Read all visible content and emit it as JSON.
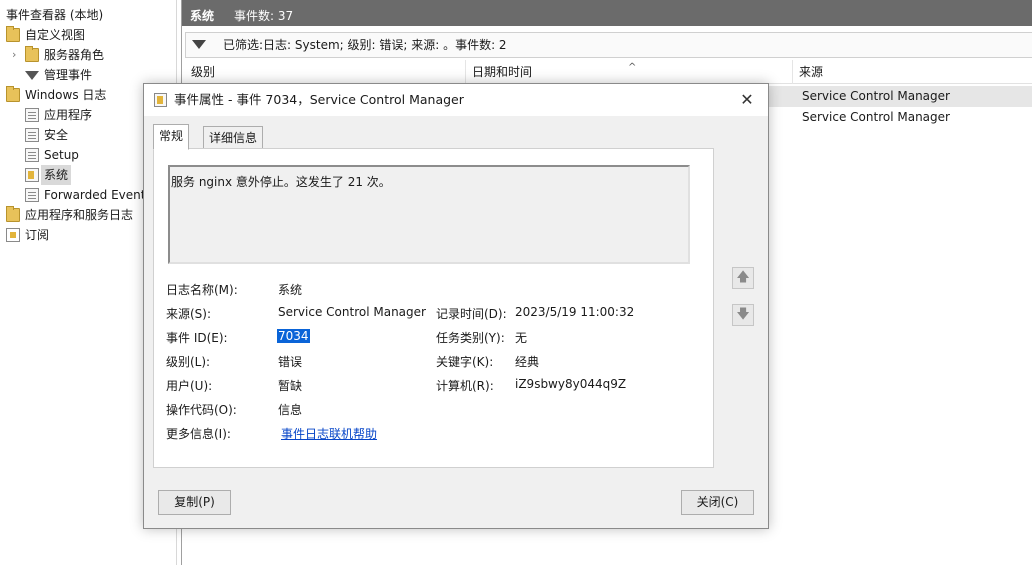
{
  "tree": {
    "root": "事件查看器 (本地)",
    "custom_views": "自定义视图",
    "server_roles": "服务器角色",
    "admin_events": "管理事件",
    "windows_logs": "Windows 日志",
    "application": "应用程序",
    "security": "安全",
    "setup": "Setup",
    "system": "系统",
    "forwarded": "Forwarded Events",
    "app_service_logs": "应用程序和服务日志",
    "subscriptions": "订阅"
  },
  "pane": {
    "title": "系统",
    "count": "事件数: 37",
    "filter_text": "已筛选:日志: System; 级别: 错误; 来源: 。事件数: 2",
    "columns": [
      "级别",
      "日期和时间",
      "来源"
    ],
    "rows": [
      {
        "source": "Service Control Manager"
      },
      {
        "source": "Service Control Manager"
      }
    ]
  },
  "dialog": {
    "title": "事件属性 - 事件 7034，Service Control Manager",
    "close_glyph": "✕",
    "tabs": [
      "常规",
      "详细信息"
    ],
    "description": "服务 nginx 意外停止。这发生了 21 次。",
    "labels": {
      "log_name": "日志名称(M):",
      "source": "来源(S):",
      "event_id": "事件 ID(E):",
      "level": "级别(L):",
      "user": "用户(U):",
      "opcode": "操作代码(O):",
      "more_info": "更多信息(I):",
      "logged": "记录时间(D):",
      "task": "任务类别(Y):",
      "keywords": "关键字(K):",
      "computer": "计算机(R):"
    },
    "values": {
      "log_name": "系统",
      "source": "Service Control Manager",
      "event_id": "7034",
      "level": "错误",
      "user": "暂缺",
      "opcode": "信息",
      "more_info": "事件日志联机帮助",
      "logged": "2023/5/19 11:00:32",
      "task": "无",
      "keywords": "经典",
      "computer": "iZ9sbwy8y044q9Z"
    },
    "scroll_up": "🡅",
    "scroll_down": "🡇",
    "copy_button": "复制(P)",
    "close_button": "关闭(C)"
  },
  "colors": {
    "header_bg": "#6b6b6b",
    "selection": "#0a64d8",
    "link": "#0645c8"
  }
}
